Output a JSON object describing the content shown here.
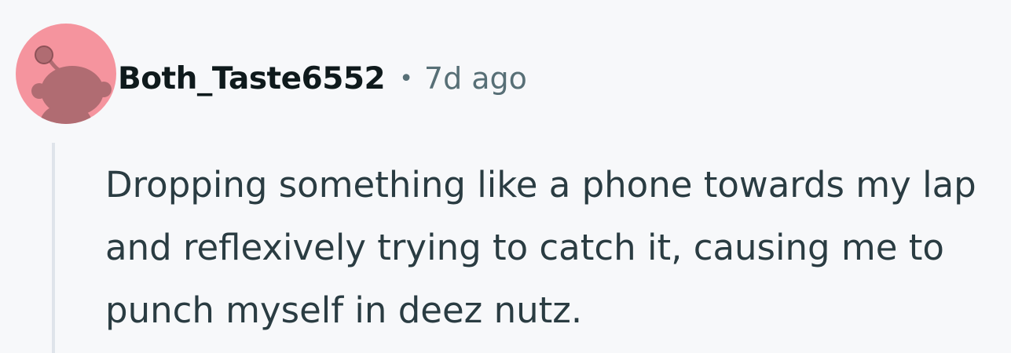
{
  "comment": {
    "author": "Both_Taste6552",
    "separator": "•",
    "time_ago": "7d ago",
    "body": "Dropping something like a phone towards my lap and reflexively trying to catch it, causing me to punch myself in deez nutz.",
    "avatar": {
      "icon": "snoo-avatar-icon",
      "background_color": "#f5949e",
      "figure_color": "#b06c72"
    }
  }
}
